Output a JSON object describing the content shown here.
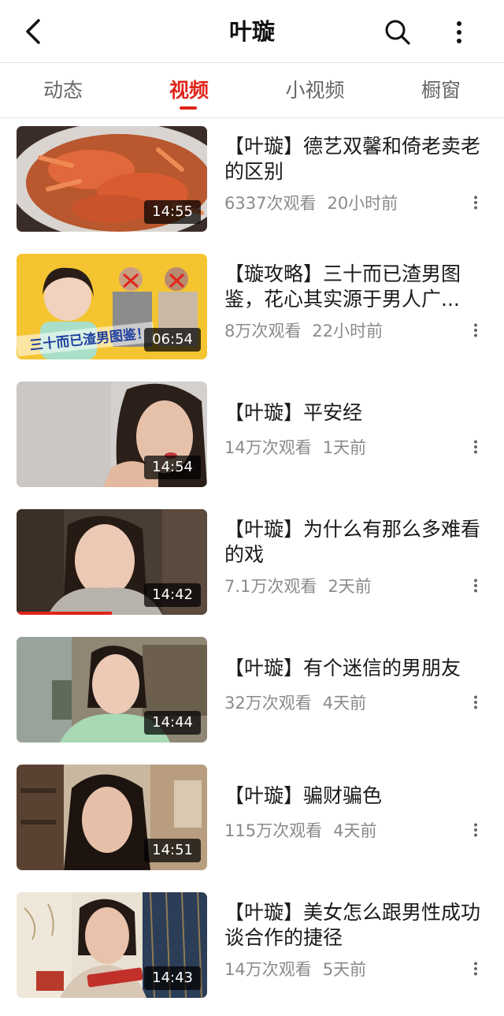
{
  "header": {
    "title": "叶璇",
    "back_icon": "chevron-left-icon",
    "search_icon": "search-icon",
    "more_icon": "more-vertical-icon"
  },
  "tabs": [
    {
      "label": "动态",
      "active": false
    },
    {
      "label": "视频",
      "active": true
    },
    {
      "label": "小视频",
      "active": false
    },
    {
      "label": "橱窗",
      "active": false
    }
  ],
  "colors": {
    "accent": "#e0241b",
    "meta_text": "#8a8a8a"
  },
  "videos": [
    {
      "title": "【叶璇】德艺双馨和倚老卖老的区别",
      "views": "6337次观看",
      "time": "20小时前",
      "duration": "14:55",
      "progress": 0
    },
    {
      "title": "【璇攻略】三十而已渣男图鉴，花心其实源于男人广...",
      "views": "8万次观看",
      "time": "22小时前",
      "duration": "06:54",
      "progress": 0,
      "thumb_text": "三十而已渣男图鉴！"
    },
    {
      "title": "【叶璇】平安经",
      "views": "14万次观看",
      "time": "1天前",
      "duration": "14:54",
      "progress": 0
    },
    {
      "title": "【叶璇】为什么有那么多难看的戏",
      "views": "7.1万次观看",
      "time": "2天前",
      "duration": "14:42",
      "progress": 0.5
    },
    {
      "title": "【叶璇】有个迷信的男朋友",
      "views": "32万次观看",
      "time": "4天前",
      "duration": "14:44",
      "progress": 0
    },
    {
      "title": "【叶璇】骗财骗色",
      "views": "115万次观看",
      "time": "4天前",
      "duration": "14:51",
      "progress": 0
    },
    {
      "title": "【叶璇】美女怎么跟男性成功谈合作的捷径",
      "views": "14万次观看",
      "time": "5天前",
      "duration": "14:43",
      "progress": 0
    }
  ]
}
